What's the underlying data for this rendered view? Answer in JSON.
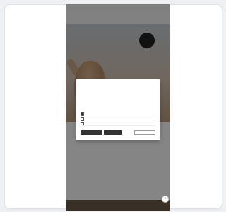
{
  "status_bar": {
    "time": "",
    "right": ""
  },
  "nav": {
    "tabs": [
      {
        "label": ""
      },
      {
        "label": ""
      }
    ]
  },
  "hero": {
    "badge_line1": "",
    "badge_line2": ""
  },
  "content": {
    "headline": "",
    "subtext": "",
    "teaser": ""
  },
  "cookie_modal": {
    "logo": "",
    "title": "",
    "body": "",
    "options": [
      {
        "label": "",
        "more": "",
        "checked": true
      },
      {
        "label": "",
        "more": "",
        "checked": false
      },
      {
        "label": "",
        "more": "",
        "checked": false
      }
    ],
    "buttons": {
      "accept_selected": "",
      "accept_all": "",
      "settings": ""
    }
  },
  "icons": {
    "scroll_top": "chevron-up-icon"
  },
  "colors": {
    "overlay": "#000000",
    "modal_bg": "#ffffff",
    "button_dark": "#333333"
  }
}
